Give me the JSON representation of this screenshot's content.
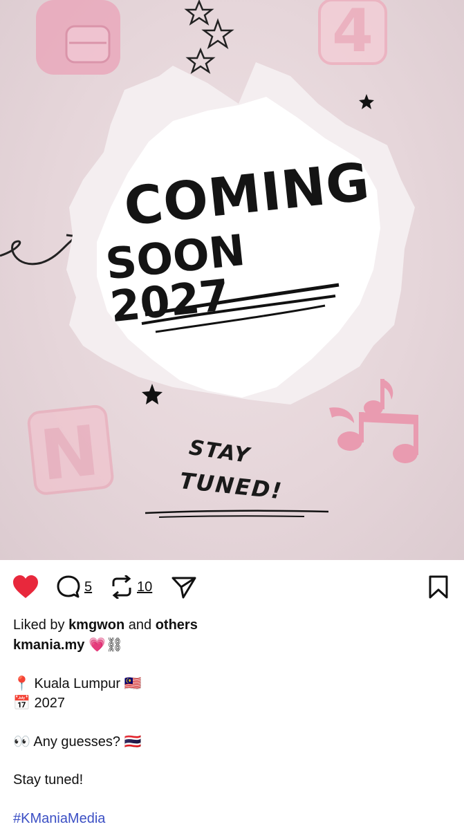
{
  "post_image": {
    "headline_line1": "COMING",
    "headline_line2": "SOON 2027",
    "subtext_line1": "STAY",
    "subtext_line2": "TUNED!",
    "decor": {
      "letter_badge_top": "4",
      "letter_badge_bottom": "N"
    }
  },
  "actions": {
    "like_icon": "heart-filled-icon",
    "comment_icon": "comment-icon",
    "comment_count": "5",
    "repost_icon": "repost-icon",
    "repost_count": "10",
    "share_icon": "send-icon",
    "save_icon": "bookmark-icon",
    "colors": {
      "like": "#e8283c"
    }
  },
  "caption": {
    "liked_prefix": "Liked by",
    "liked_user": "kmgwon",
    "liked_and": "and",
    "liked_others": "others",
    "author": "kmania.my",
    "author_emoji": "💗⛓",
    "location_pin": "📍",
    "location": "Kuala Lumpur",
    "location_flag": "🇲🇾",
    "calendar_icon": "📅",
    "year": "2027",
    "eyes_icon": "👀",
    "question": "Any guesses?",
    "question_flag": "🇹🇭",
    "closing": "Stay tuned!",
    "hashtag": "#KManiaMedia",
    "hashtag_color": "#3b4fc4"
  }
}
